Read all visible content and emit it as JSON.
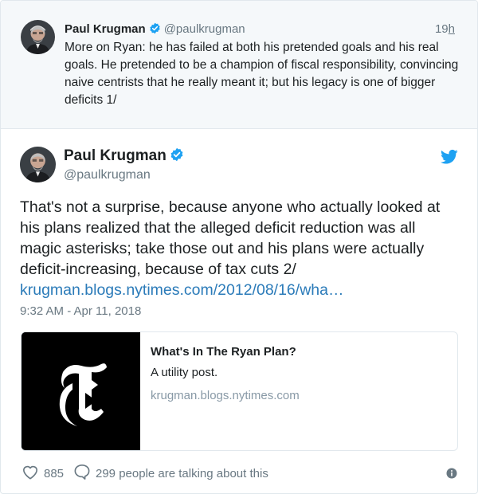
{
  "parent_tweet": {
    "author_name": "Paul Krugman",
    "handle": "@paulkrugman",
    "time_prefix": "19",
    "time_unit": "h",
    "text": "More on Ryan: he has failed at both his pretended goals and his real goals. He pretended to be a champion of fiscal responsibility, convincing naive centrists that he really meant it; but his legacy is one of bigger deficits 1/"
  },
  "tweet": {
    "author_name": "Paul Krugman",
    "handle": "@paulkrugman",
    "text": "That's not a surprise, because anyone who actually looked at his plans realized that the alleged deficit reduction was all magic asterisks; take those out and his plans were actually deficit-increasing, because of tax cuts 2/",
    "link_text": "krugman.blogs.nytimes.com/2012/08/16/wha…",
    "timestamp": "9:32 AM - Apr 11, 2018"
  },
  "card": {
    "title": "What's In The Ryan Plan?",
    "description": "A utility post.",
    "domain": "krugman.blogs.nytimes.com"
  },
  "actions": {
    "likes": "885",
    "talking": "299 people are talking about this"
  },
  "icons": {
    "verified": "verified-badge-icon",
    "twitter": "twitter-bird-icon",
    "like": "heart-icon",
    "reply": "speech-bubble-icon",
    "info": "info-icon"
  },
  "colors": {
    "accent": "#1da1f2",
    "link": "#2b7bb9",
    "muted": "#697882",
    "parent_bg": "#f5f8fa"
  }
}
